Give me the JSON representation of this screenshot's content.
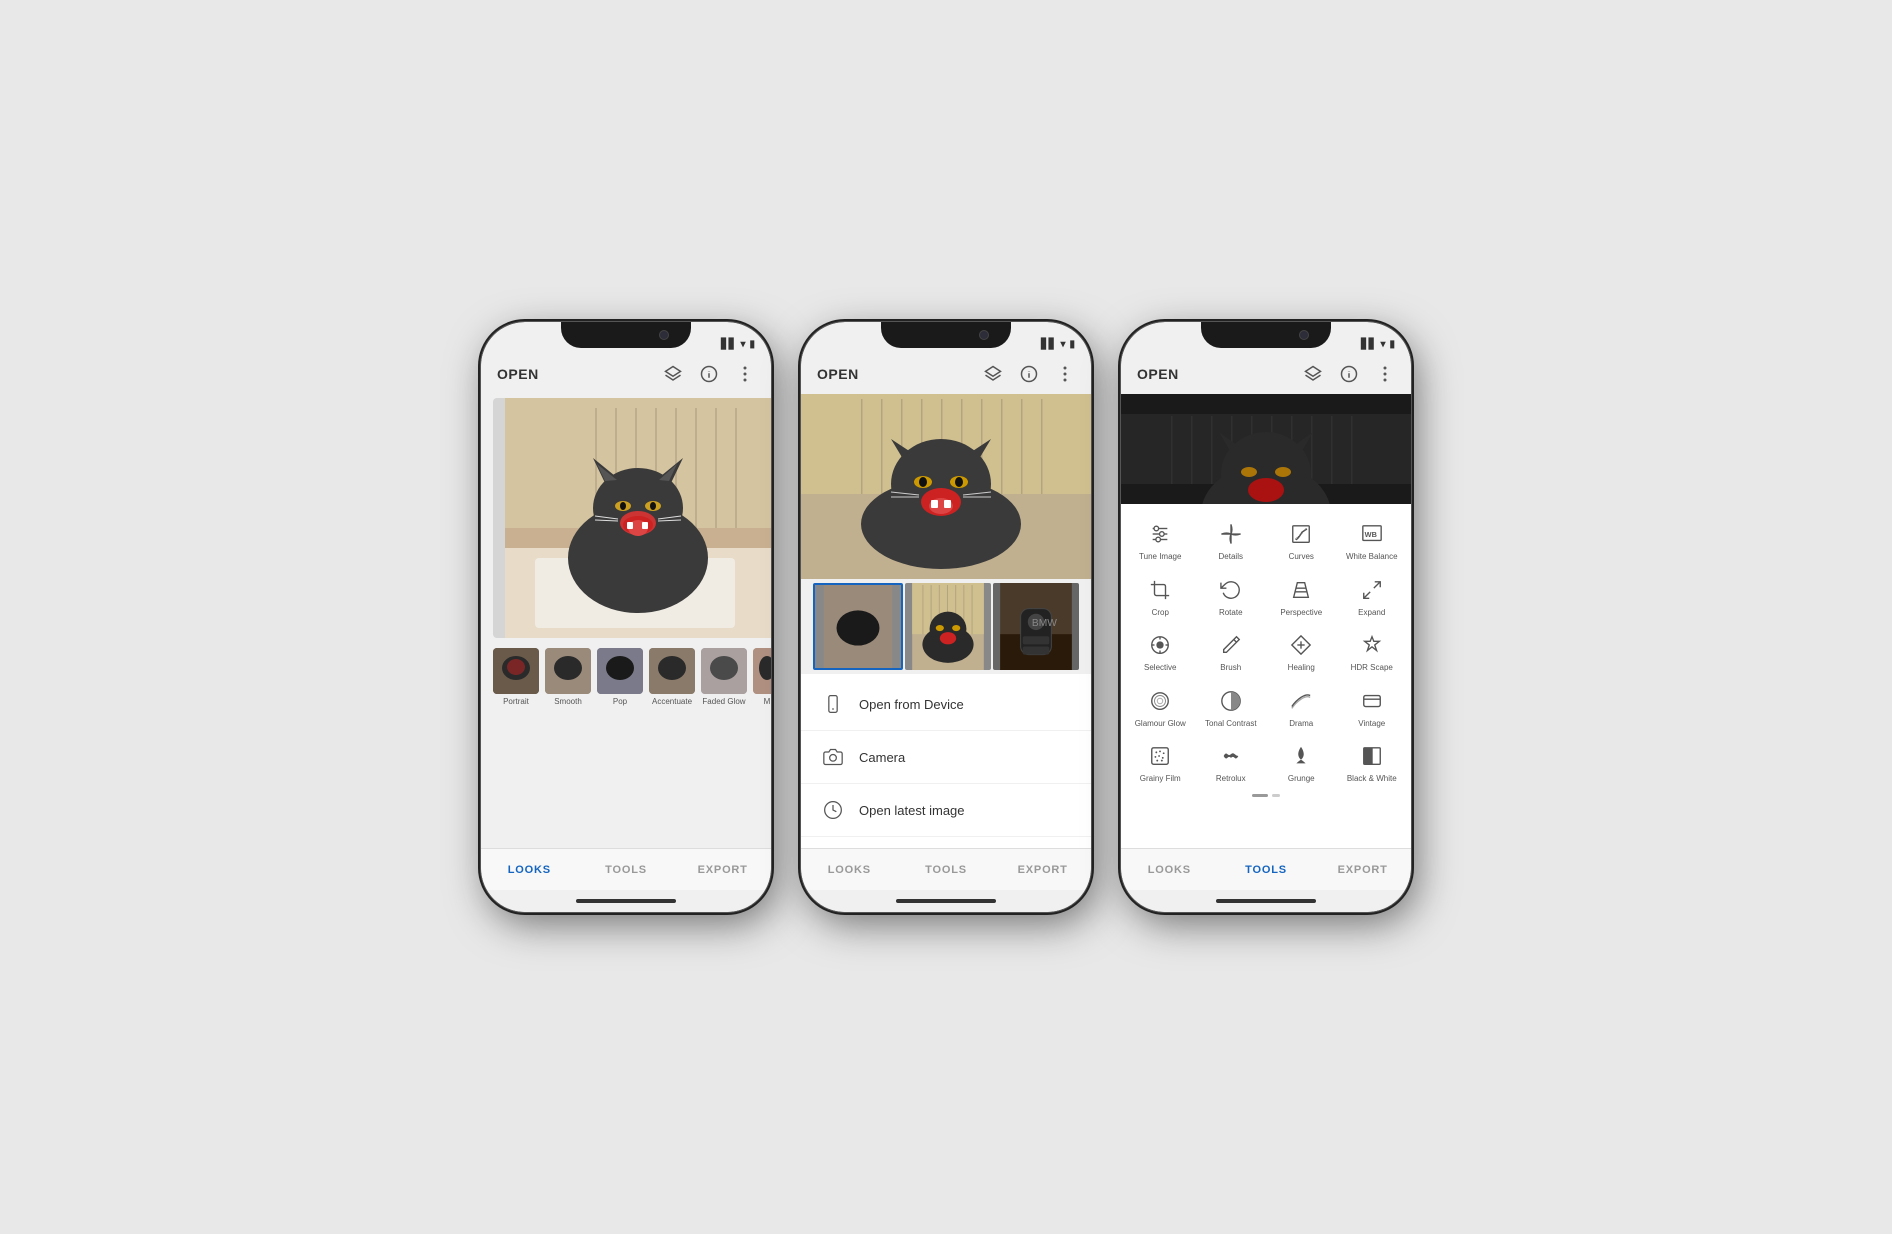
{
  "phones": [
    {
      "id": "phone1",
      "screen": "looks",
      "header": {
        "open_label": "OPEN",
        "icons": [
          "layers-icon",
          "info-icon",
          "more-icon"
        ]
      },
      "nav": {
        "items": [
          {
            "label": "LOOKS",
            "active": true
          },
          {
            "label": "TOOLS",
            "active": false
          },
          {
            "label": "EXPORT",
            "active": false
          }
        ]
      },
      "looks": [
        {
          "label": "Portrait"
        },
        {
          "label": "Smooth"
        },
        {
          "label": "Pop"
        },
        {
          "label": "Accentuate"
        },
        {
          "label": "Faded Glow"
        },
        {
          "label": "M"
        }
      ]
    },
    {
      "id": "phone2",
      "screen": "open",
      "header": {
        "open_label": "OPEN",
        "icons": [
          "layers-icon",
          "info-icon",
          "more-icon"
        ]
      },
      "nav": {
        "items": [
          {
            "label": "LOOKS",
            "active": false
          },
          {
            "label": "TOOLS",
            "active": false
          },
          {
            "label": "EXPORT",
            "active": false
          }
        ]
      },
      "menu_items": [
        {
          "icon": "phone-icon",
          "label": "Open from Device"
        },
        {
          "icon": "camera-icon",
          "label": "Camera"
        },
        {
          "icon": "clock-icon",
          "label": "Open latest image"
        }
      ]
    },
    {
      "id": "phone3",
      "screen": "tools",
      "header": {
        "open_label": "OPEN",
        "icons": [
          "layers-icon",
          "info-icon",
          "more-icon"
        ]
      },
      "nav": {
        "items": [
          {
            "label": "LOOKS",
            "active": false
          },
          {
            "label": "TOOLS",
            "active": true
          },
          {
            "label": "EXPORT",
            "active": false
          }
        ]
      },
      "tools": [
        {
          "icon": "tune-icon",
          "label": "Tune Image"
        },
        {
          "icon": "details-icon",
          "label": "Details"
        },
        {
          "icon": "curves-icon",
          "label": "Curves"
        },
        {
          "icon": "wb-icon",
          "label": "White Balance"
        },
        {
          "icon": "crop-icon",
          "label": "Crop"
        },
        {
          "icon": "rotate-icon",
          "label": "Rotate"
        },
        {
          "icon": "perspective-icon",
          "label": "Perspective"
        },
        {
          "icon": "expand-icon",
          "label": "Expand"
        },
        {
          "icon": "selective-icon",
          "label": "Selective"
        },
        {
          "icon": "brush-icon",
          "label": "Brush"
        },
        {
          "icon": "healing-icon",
          "label": "Healing"
        },
        {
          "icon": "hdr-icon",
          "label": "HDR Scape"
        },
        {
          "icon": "glamour-icon",
          "label": "Glamour Glow"
        },
        {
          "icon": "tonal-icon",
          "label": "Tonal Contrast"
        },
        {
          "icon": "drama-icon",
          "label": "Drama"
        },
        {
          "icon": "vintage-icon",
          "label": "Vintage"
        },
        {
          "icon": "grainy-icon",
          "label": "Grainy Film"
        },
        {
          "icon": "retrolux-icon",
          "label": "Retrolux"
        },
        {
          "icon": "grunge-icon",
          "label": "Grunge"
        },
        {
          "icon": "bw-icon",
          "label": "Black & White"
        }
      ]
    }
  ]
}
